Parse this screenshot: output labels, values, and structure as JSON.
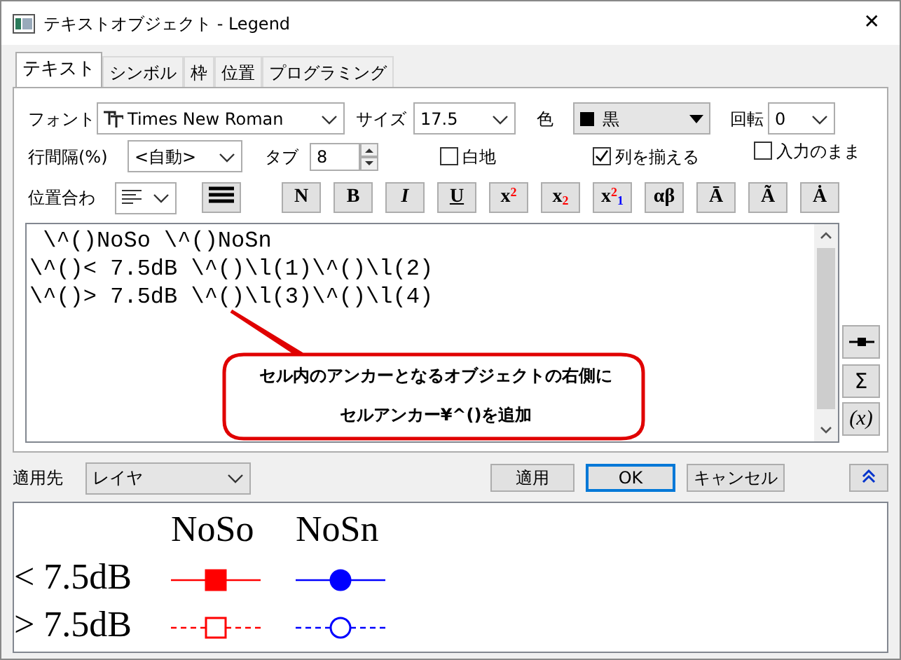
{
  "window": {
    "title": "テキストオブジェクト - Legend",
    "close": "✕"
  },
  "tabs": [
    {
      "label": "テキスト",
      "selected": true
    },
    {
      "label": "シンボル",
      "selected": false
    },
    {
      "label": "枠",
      "selected": false
    },
    {
      "label": "位置",
      "selected": false
    },
    {
      "label": "プログラミング",
      "selected": false
    }
  ],
  "font": {
    "label": "フォント",
    "value": "Times New Roman"
  },
  "size": {
    "label": "サイズ",
    "value": "17.5"
  },
  "color": {
    "label": "色",
    "value": "黒"
  },
  "rotation": {
    "label": "回転",
    "value": "0"
  },
  "line_spacing": {
    "label": "行間隔(%)",
    "value": "<自動>"
  },
  "tab_width": {
    "label": "タブ",
    "value": "8"
  },
  "checkboxes": [
    {
      "label": "白地",
      "checked": false
    },
    {
      "label": "列を揃える",
      "checked": true
    },
    {
      "label": "入力のまま",
      "checked": false
    }
  ],
  "alignment": {
    "label": "位置合わ"
  },
  "format_buttons": [
    {
      "text": "N",
      "kind": "normal"
    },
    {
      "text": "B",
      "kind": "bold"
    },
    {
      "text": "I",
      "kind": "italic"
    },
    {
      "text": "U",
      "kind": "underline"
    },
    {
      "text": "x$^{2}$",
      "kind": "sup"
    },
    {
      "text": "x$_{2}$",
      "kind": "sub"
    },
    {
      "text": "x$^{2}$$_{1}$",
      "kind": "supsub"
    },
    {
      "text": "αβ",
      "kind": "greek"
    },
    {
      "text": "Ā",
      "kind": "accent"
    },
    {
      "text": "Ã",
      "kind": "accent"
    },
    {
      "text": "Ȧ",
      "kind": "accent"
    }
  ],
  "editor": {
    "lines": [
      " \\^()NoSo \\^()NoSn",
      "\\^()< 7.5dB \\^()\\l(1)\\^()\\l(2)",
      "\\^()> 7.5dB \\^()\\l(3)\\^()\\l(4)"
    ]
  },
  "callout": {
    "lines": [
      "セル内のアンカーとなるオブジェクトの右側に",
      "セルアンカー¥^()を追加"
    ]
  },
  "side_buttons": [
    {
      "kind": "symbol"
    },
    {
      "kind": "text",
      "text": "Σ"
    },
    {
      "kind": "text",
      "text": "(x)"
    }
  ],
  "apply_to": {
    "label": "適用先",
    "value": "レイヤ"
  },
  "buttons": [
    {
      "label": "適用",
      "default": false
    },
    {
      "label": "OK",
      "default": true
    },
    {
      "label": "キャンセル",
      "default": false
    }
  ],
  "preview": {
    "headers": [
      "NoSo",
      "NoSn"
    ],
    "rows": [
      {
        "label": "< 7.5dB",
        "symbols": [
          {
            "color": "#ff0000",
            "kind": "square",
            "filled": true,
            "dashed": false
          },
          {
            "color": "#0000ff",
            "kind": "circle",
            "filled": true,
            "dashed": false
          }
        ]
      },
      {
        "label": "> 7.5dB",
        "symbols": [
          {
            "color": "#ff0000",
            "kind": "square",
            "filled": false,
            "dashed": true
          },
          {
            "color": "#0000ff",
            "kind": "circle",
            "filled": false,
            "dashed": true
          }
        ]
      }
    ]
  }
}
